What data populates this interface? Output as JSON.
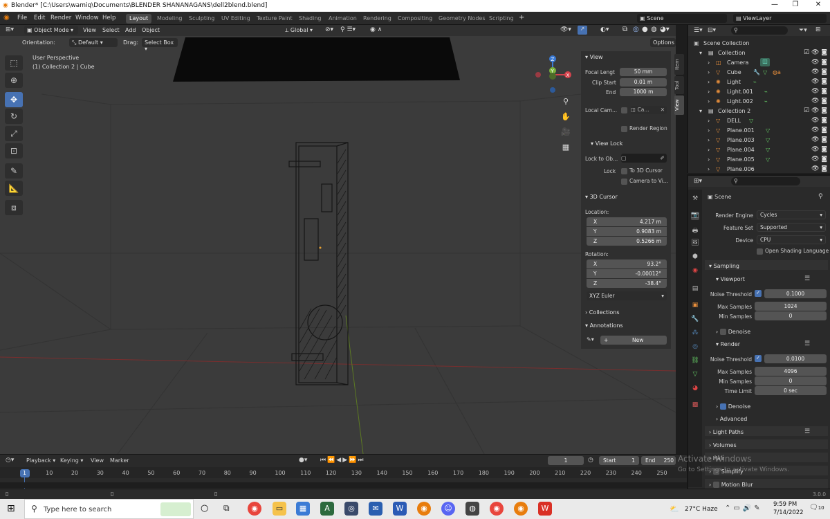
{
  "window": {
    "title": "Blender* [C:\\Users\\wamiq\\Documents\\BLENDER SHANANAGANS\\dell2blend.blend]",
    "minimize": "—",
    "maximize": "❐",
    "close": "✕"
  },
  "topbar": {
    "menus": [
      "File",
      "Edit",
      "Render",
      "Window",
      "Help"
    ],
    "workspaces": [
      "Layout",
      "Modeling",
      "Sculpting",
      "UV Editing",
      "Texture Paint",
      "Shading",
      "Animation",
      "Rendering",
      "Compositing",
      "Geometry Nodes",
      "Scripting"
    ],
    "add_tab": "+",
    "scene": "Scene",
    "view_layer": "ViewLayer"
  },
  "header": {
    "mode": "Object Mode",
    "menus": [
      "View",
      "Select",
      "Add",
      "Object"
    ],
    "transform": "Global",
    "orientation_label": "Orientation:",
    "orientation": "Default",
    "drag_label": "Drag:",
    "drag": "Select Box",
    "options": "Options"
  },
  "viewport": {
    "perspective": "User Perspective",
    "context": "(1) Collection 2 | Cube"
  },
  "npanel": {
    "tabs": [
      "Item",
      "Tool",
      "View"
    ],
    "view_head": "View",
    "focal_label": "Focal Lengt",
    "focal": "50 mm",
    "clip_start_label": "Clip Start",
    "clip_start": "0.01 m",
    "end_label": "End",
    "end": "1000 m",
    "local_cam_label": "Local Cam...",
    "local_cam": "Ca...",
    "render_region": "Render Region",
    "view_lock_head": "View Lock",
    "lock_to_label": "Lock to Ob...",
    "lock_label": "Lock",
    "lock_3d": "To 3D Cursor",
    "lock_cam": "Camera to Vi...",
    "cursor_head": "3D Cursor",
    "location_label": "Location:",
    "loc_x": "4.217 m",
    "loc_y": "0.9083 m",
    "loc_z": "0.5266 m",
    "rotation_label": "Rotation:",
    "rot_x": "93.2°",
    "rot_y": "-0.00012°",
    "rot_z": "-38.4°",
    "euler": "XYZ Euler",
    "collections": "Collections",
    "annotations": "Annotations",
    "new": "New",
    "x": "X",
    "y": "Y",
    "z": "Z"
  },
  "outliner": {
    "rows": [
      "Scene Collection",
      "Collection",
      "Camera",
      "Cube",
      "Light",
      "Light.001",
      "Light.002",
      "Collection 2",
      "DELL",
      "Plane.001",
      "Plane.003",
      "Plane.004",
      "Plane.005",
      "Plane.006"
    ]
  },
  "properties": {
    "scene": "Scene",
    "render_engine_label": "Render Engine",
    "render_engine": "Cycles",
    "feature_set_label": "Feature Set",
    "feature_set": "Supported",
    "device_label": "Device",
    "device": "CPU",
    "osl": "Open Shading Language",
    "sampling": "Sampling",
    "viewport": "Viewport",
    "noise_threshold_label": "Noise Threshold",
    "vp_noise": "0.1000",
    "max_samples_label": "Max Samples",
    "vp_max": "1024",
    "min_samples_label": "Min Samples",
    "vp_min": "0",
    "denoise": "Denoise",
    "render": "Render",
    "r_noise": "0.0100",
    "r_max": "4096",
    "r_min": "0",
    "time_limit_label": "Time Limit",
    "time_limit": "0 sec",
    "advanced": "Advanced",
    "light_paths": "Light Paths",
    "volumes": "Volumes",
    "hair": "Hair",
    "simplify": "Simplify",
    "motion_blur": "Motion Blur"
  },
  "timeline": {
    "menus": [
      "Playback",
      "Keying",
      "View",
      "Marker"
    ],
    "current": "1",
    "start_label": "Start",
    "start": "1",
    "end_label": "End",
    "end": "250",
    "ticks": [
      "1",
      "10",
      "20",
      "30",
      "40",
      "50",
      "60",
      "70",
      "80",
      "90",
      "100",
      "110",
      "120",
      "130",
      "140",
      "150",
      "160",
      "170",
      "180",
      "190",
      "200",
      "210",
      "220",
      "230",
      "240",
      "250"
    ]
  },
  "statusbar": {
    "version": "3.0.0"
  },
  "watermark": {
    "line1": "Activate Windows",
    "line2": "Go to Settings to activate Windows."
  },
  "taskbar": {
    "search": "Type here to search",
    "weather": "27°C  Haze",
    "time": "9:59 PM",
    "date": "7/14/2022",
    "notif": "10"
  }
}
